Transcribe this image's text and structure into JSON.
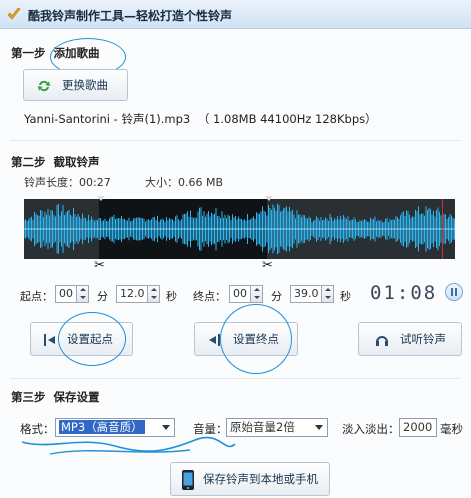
{
  "window": {
    "title": "酷我铃声制作工具—轻松打造个性铃声"
  },
  "step1": {
    "prefix": "第一步",
    "title": "添加歌曲",
    "change_button": "更换歌曲",
    "file_name": "Yanni-Santorini - 铃声(1).mp3",
    "file_info": "（ 1.08MB 44100Hz  128Kbps）"
  },
  "step2": {
    "prefix": "第二步",
    "title": "截取铃声",
    "length_label": "铃声长度：",
    "length_value": "00:27",
    "size_label": "大小：",
    "size_value": "0.66 MB",
    "start": {
      "label": "起点：",
      "min": "00",
      "min_unit": "分",
      "sec": "12.0",
      "sec_unit": "秒"
    },
    "end": {
      "label": "终点：",
      "min": "00",
      "min_unit": "分",
      "sec": "39.0",
      "sec_unit": "秒"
    },
    "timer": "01:08",
    "set_start_button": "设置起点",
    "set_end_button": "设置终点",
    "listen_button": "试听铃声"
  },
  "step3": {
    "prefix": "第三步",
    "title": "保存设置",
    "format_label": "格式：",
    "format_value": "MP3（高音质）",
    "volume_label": "音量：",
    "volume_value": "原始音量2倍",
    "fade_label": "淡入淡出：",
    "fade_value": "2000",
    "fade_unit": "毫秒",
    "save_button": "保存铃声到本地或手机"
  },
  "colors": {
    "accent": "#1f90d8",
    "waveform": "#2fb5f0",
    "waveform_bg": "#2a2f34",
    "selection_bg": "#101316",
    "marker": "#d0302a"
  }
}
